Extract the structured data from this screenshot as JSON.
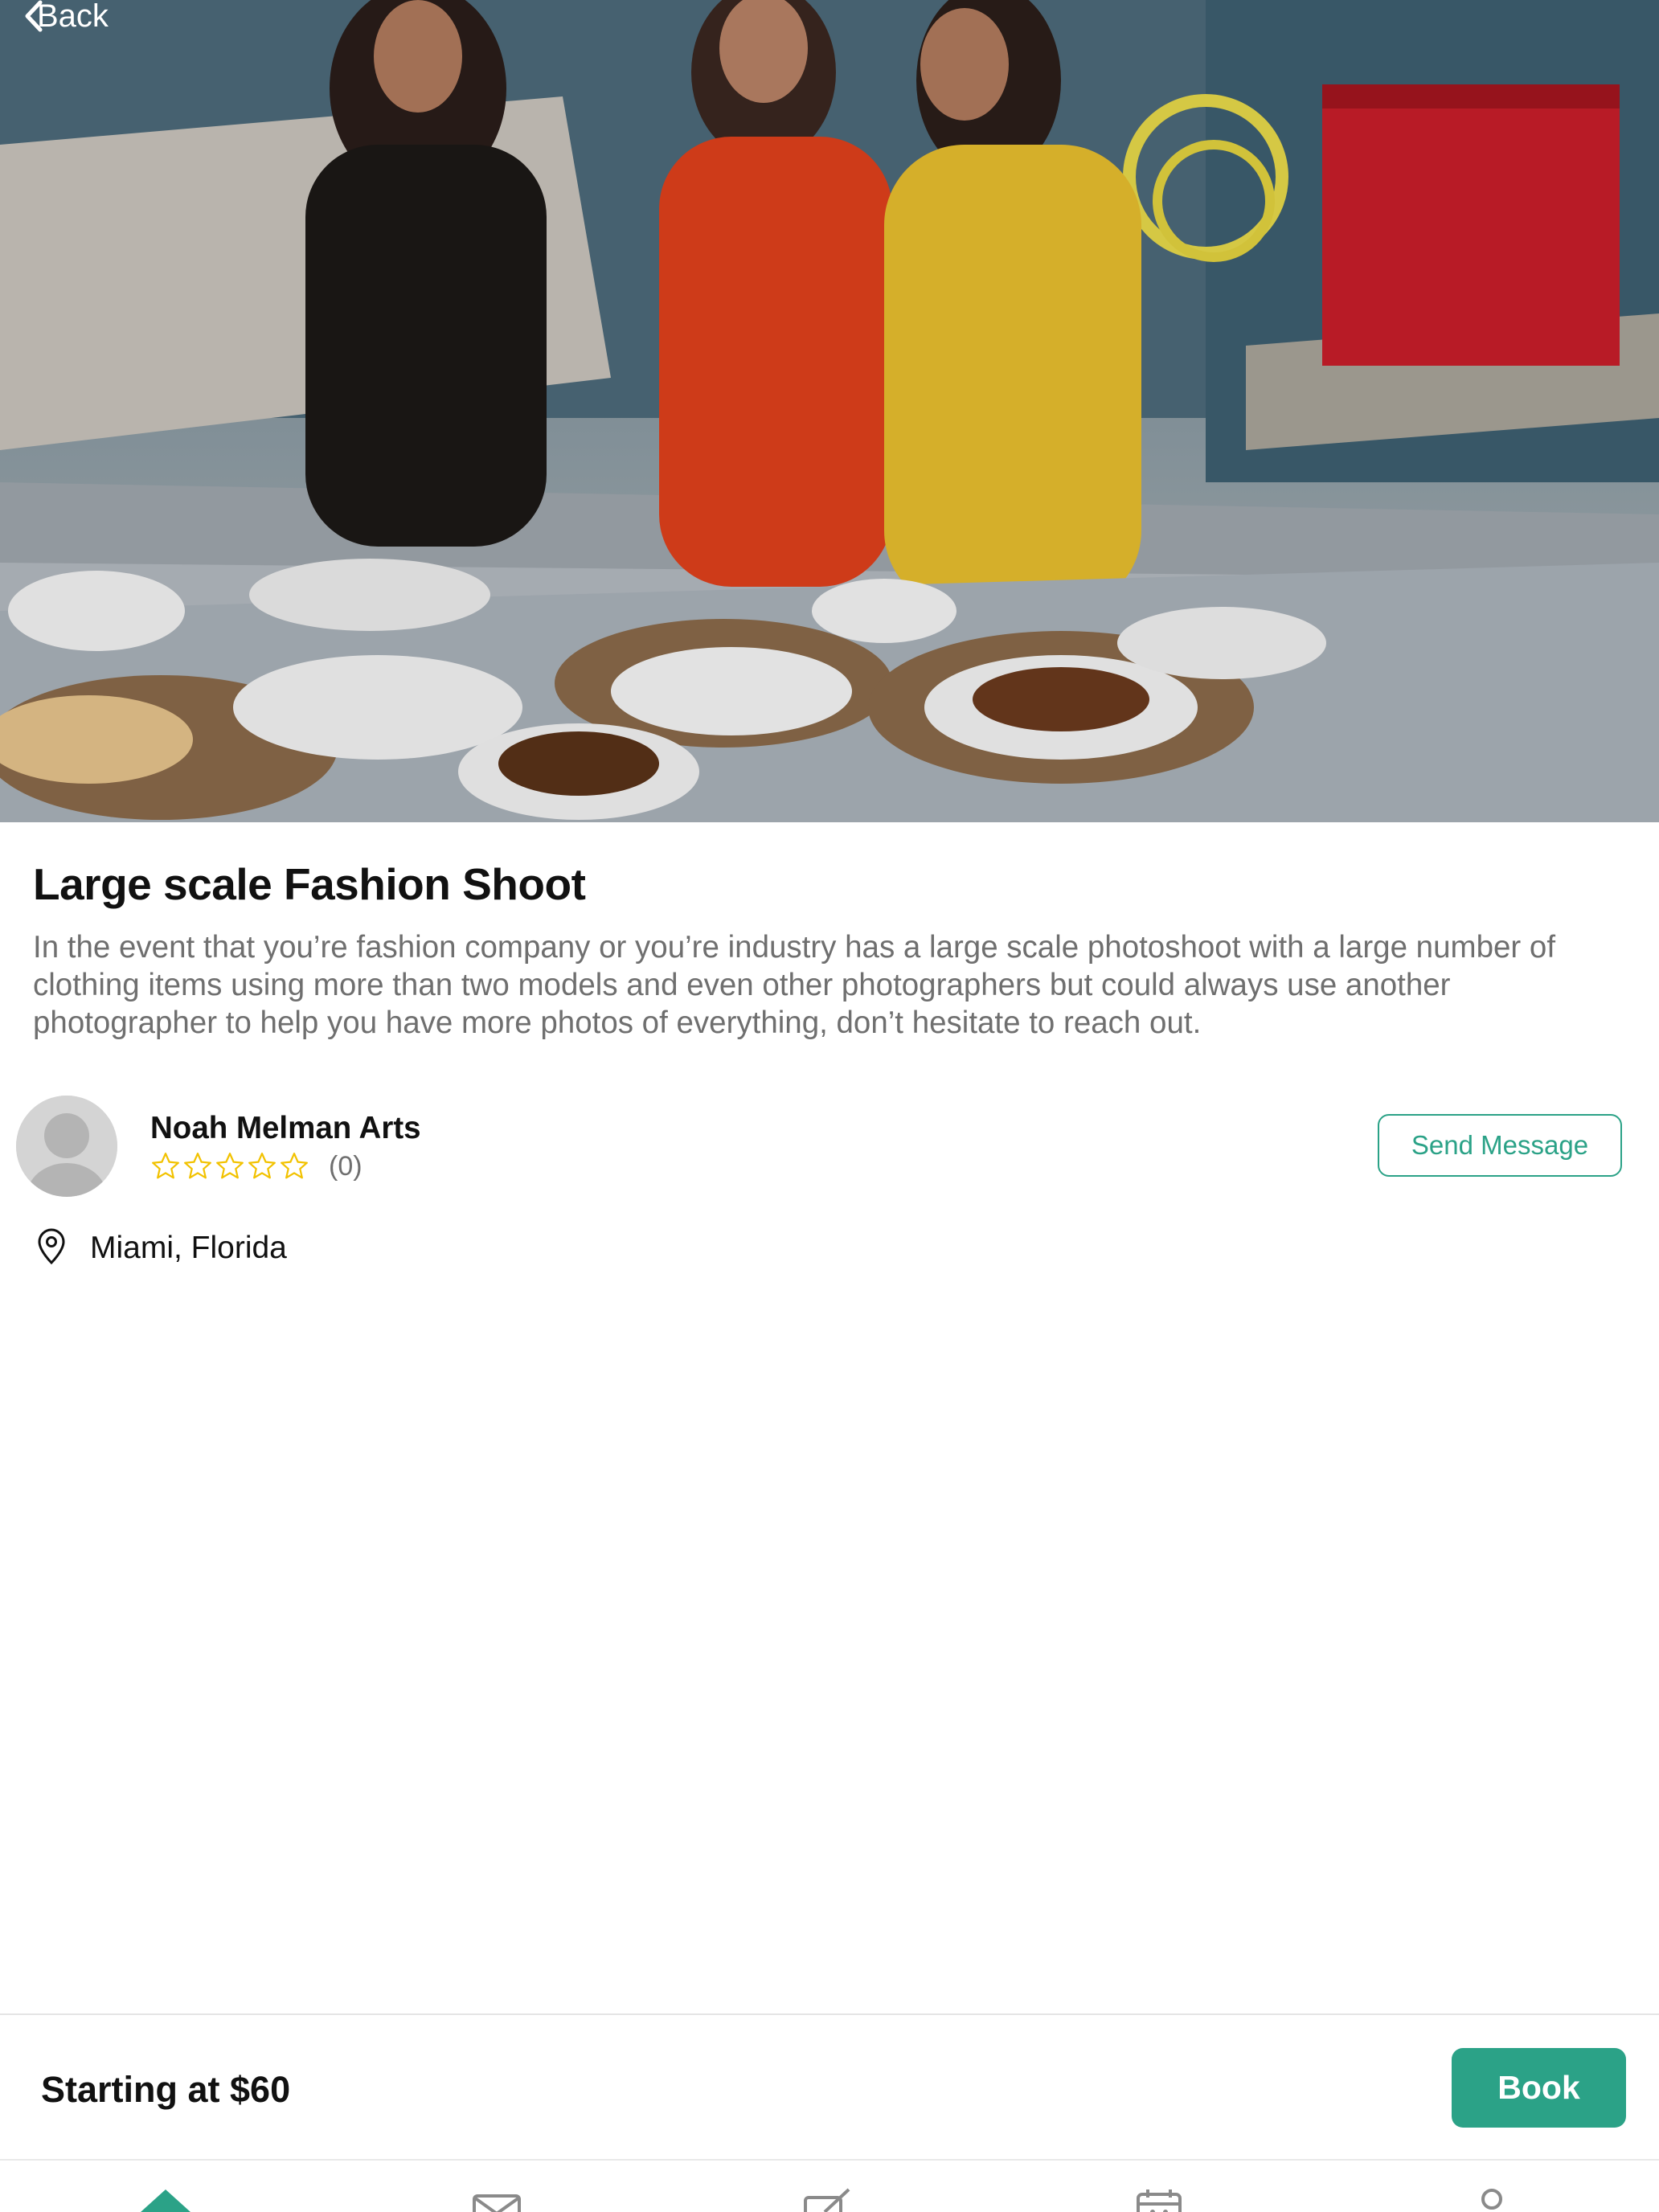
{
  "nav": {
    "back_label": "Back"
  },
  "service": {
    "title": "Large scale Fashion Shoot",
    "description": "In the event that you’re fashion company or you’re industry has a large scale photoshoot with a large number of clothing items using more than two models and even other photographers but could always use another photographer to help you have more photos of everything, don’t hesitate to reach out."
  },
  "provider": {
    "name": "Noah Melman Arts",
    "rating": 0,
    "rating_max": 5,
    "review_count_label": "(0)",
    "send_message_label": "Send Message"
  },
  "location": {
    "text": "Miami, Florida",
    "icon": "location-pin-icon"
  },
  "booking": {
    "price_label": "Starting at $60",
    "book_label": "Book"
  },
  "tabs": [
    {
      "icon": "home-icon",
      "active": true
    },
    {
      "icon": "mail-icon",
      "active": false
    },
    {
      "icon": "edit-icon",
      "active": false
    },
    {
      "icon": "calendar-icon",
      "active": false
    },
    {
      "icon": "profile-icon",
      "active": false
    }
  ],
  "colors": {
    "accent": "#2ba287",
    "star": "#f2c200",
    "muted_text": "#6f6f6f"
  }
}
